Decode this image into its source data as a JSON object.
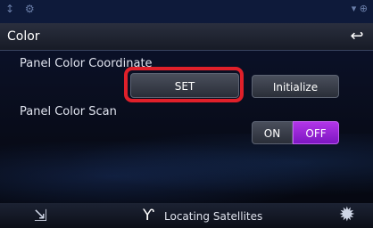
{
  "status": {
    "left_icons": "↕ ⚙",
    "right_icons": "▾ ⊕"
  },
  "header": {
    "title": "Color",
    "back_icon": "↩"
  },
  "panel_color_coordinate": {
    "label": "Panel Color Coordinate",
    "set_label": "SET",
    "initialize_label": "Initialize"
  },
  "panel_color_scan": {
    "label": "Panel Color Scan",
    "on_label": "ON",
    "off_label": "OFF",
    "selected": "OFF"
  },
  "footer": {
    "nav_icon": "⇲",
    "gps_icon": "Ƴ",
    "gps_status": "Locating Satellites",
    "settings_icon": "✹"
  },
  "colors": {
    "highlight": "#e0202a",
    "toggle_selected": "#a526e0"
  }
}
